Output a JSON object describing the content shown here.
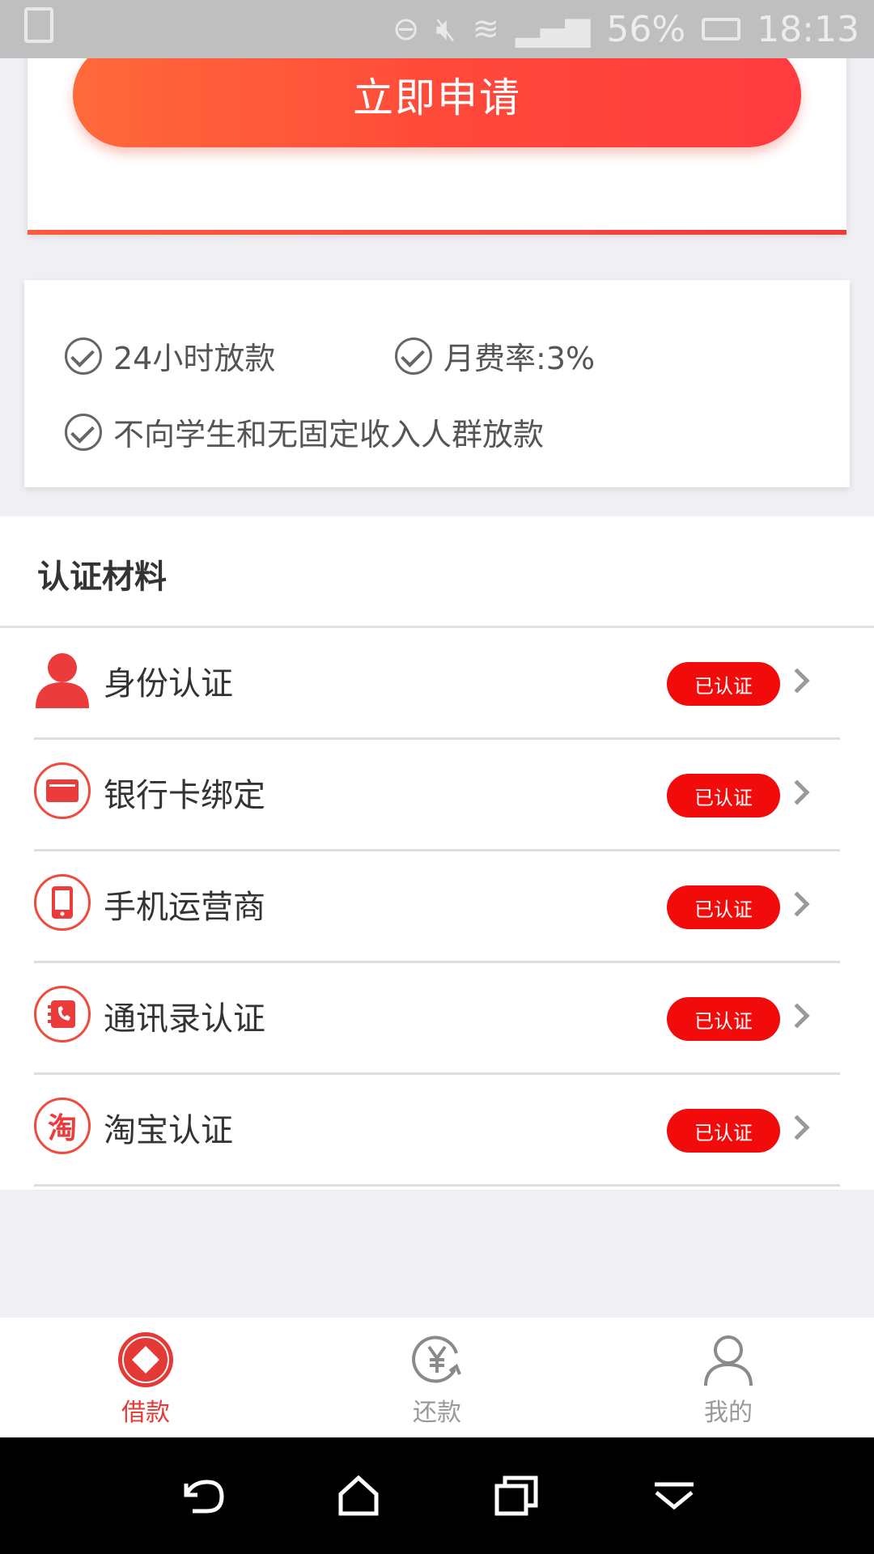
{
  "status_bar": {
    "battery": "56%",
    "time": "18:13"
  },
  "apply": {
    "button_label": "立即申请"
  },
  "features": [
    {
      "text": "24小时放款"
    },
    {
      "text": "月费率:3%"
    },
    {
      "text": "不向学生和无固定收入人群放款"
    }
  ],
  "certification": {
    "title": "认证材料",
    "items": [
      {
        "label": "身份认证",
        "status": "已认证",
        "icon": "person-icon"
      },
      {
        "label": "银行卡绑定",
        "status": "已认证",
        "icon": "bank-card-icon"
      },
      {
        "label": "手机运营商",
        "status": "已认证",
        "icon": "mobile-phone-icon"
      },
      {
        "label": "通讯录认证",
        "status": "已认证",
        "icon": "contacts-icon"
      },
      {
        "label": "淘宝认证",
        "status": "已认证",
        "icon": "taobao-icon",
        "icon_text": "淘"
      }
    ]
  },
  "bottom_nav": {
    "items": [
      {
        "label": "借款",
        "icon": "loan-icon",
        "active": true
      },
      {
        "label": "还款",
        "icon": "repay-icon",
        "active": false
      },
      {
        "label": "我的",
        "icon": "profile-icon",
        "active": false
      }
    ]
  },
  "colors": {
    "accent": "#f20b0b",
    "button_gradient_start": "#ff6a3b",
    "button_gradient_end": "#ff3b3f",
    "background": "#f0eff4"
  }
}
